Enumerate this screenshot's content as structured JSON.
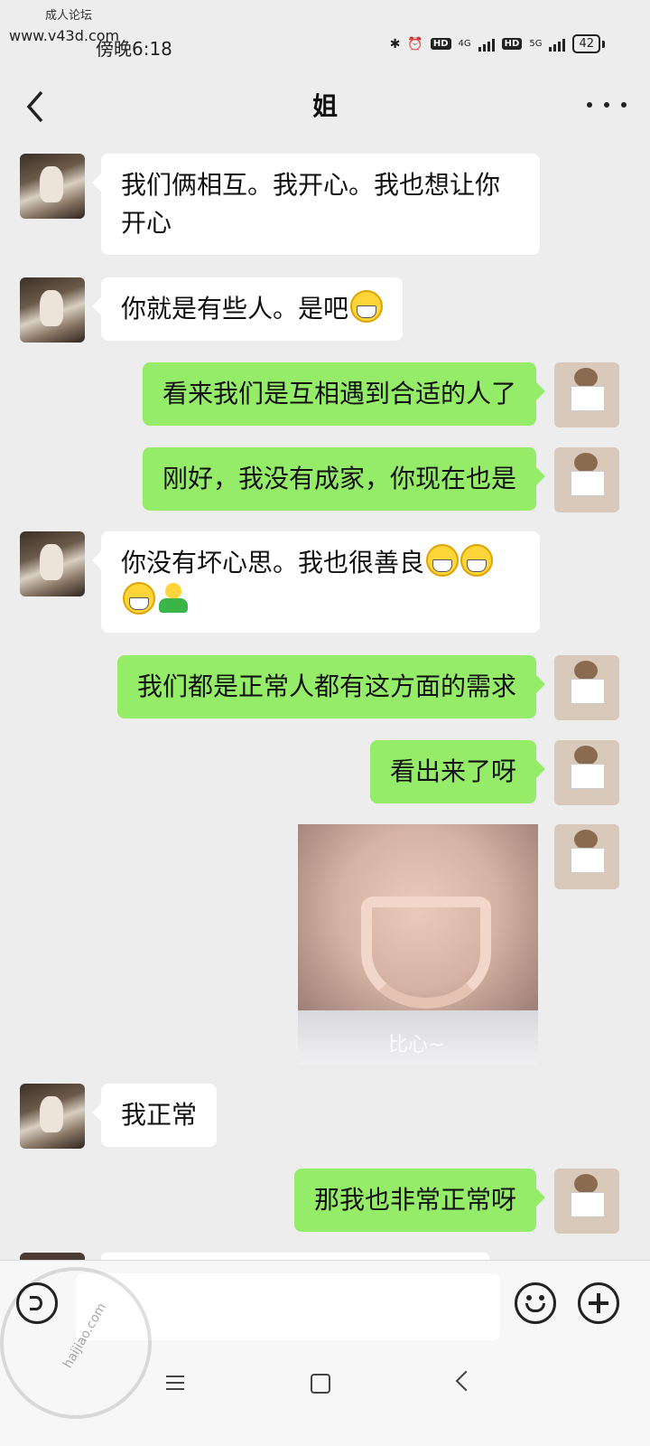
{
  "watermark": {
    "top_text": "成人论坛",
    "url": "www.v43d.com",
    "badge_text": "haijiao.com"
  },
  "status_bar": {
    "time": "傍晚6:18",
    "hd1": "HD",
    "net1": "4G",
    "hd2": "HD",
    "net2": "5G",
    "battery": "42"
  },
  "header": {
    "title": "姐"
  },
  "messages": [
    {
      "side": "left",
      "text": "我们俩相互。我开心。我也想让你开心"
    },
    {
      "side": "left",
      "text": "你就是有些人。是吧"
    },
    {
      "side": "right",
      "text": "看来我们是互相遇到合适的人了"
    },
    {
      "side": "right",
      "text": "刚好，我没有成家，你现在也是"
    },
    {
      "side": "left",
      "text": "你没有坏心思。我也很善良"
    },
    {
      "side": "right",
      "text": "我们都是正常人都有这方面的需求"
    },
    {
      "side": "right",
      "text": "看出来了呀"
    },
    {
      "side": "right",
      "type": "image",
      "caption": "比心~"
    },
    {
      "side": "left",
      "text": "我正常"
    },
    {
      "side": "right",
      "text": "那我也非常正常呀"
    }
  ],
  "colors": {
    "background": "#ededed",
    "bubble_right": "#95ec69",
    "bubble_left": "#ffffff"
  },
  "icons": [
    "back-icon",
    "more-icon",
    "voice-icon",
    "emoji-icon",
    "plus-icon",
    "menu-icon",
    "home-icon",
    "nav-back-icon"
  ]
}
